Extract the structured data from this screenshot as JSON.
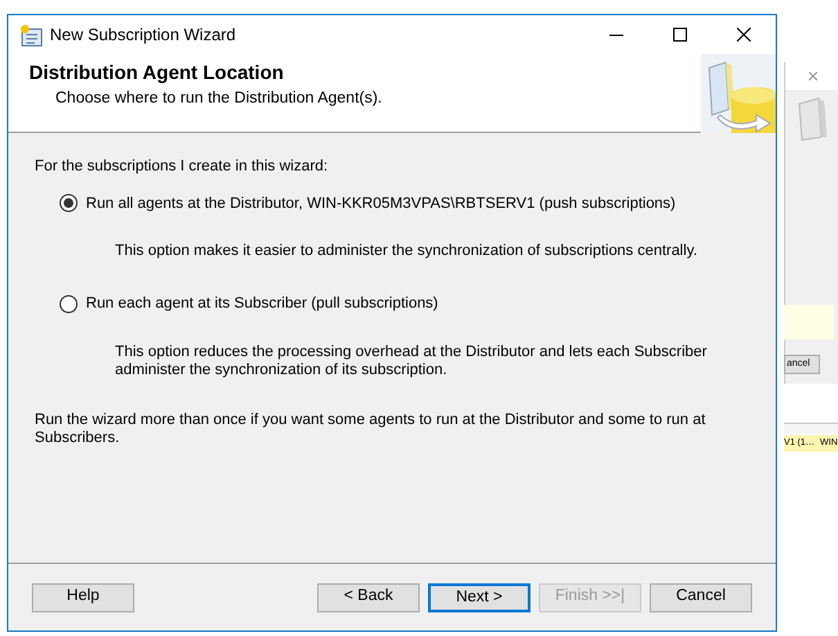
{
  "background_window": {
    "button": "ancel",
    "cells": [
      "V1 (1…",
      "WIN"
    ]
  },
  "window": {
    "title": "New Subscription Wizard"
  },
  "header": {
    "title": "Distribution Agent Location",
    "subtitle": "Choose where to run the Distribution Agent(s)."
  },
  "intro": "For the subscriptions I create in this wizard:",
  "options": [
    {
      "label": "Run all agents at the Distributor, WIN-KKR05M3VPAS\\RBTSERV1 (push subscriptions)",
      "description": "This option makes it easier to administer the synchronization of subscriptions centrally.",
      "selected": true
    },
    {
      "label": "Run each agent at its Subscriber (pull subscriptions)",
      "description": "This option reduces the processing overhead at the Distributor and lets each Subscriber administer the synchronization of its subscription.",
      "selected": false
    }
  ],
  "note": "Run the wizard more than once if you want some agents to run at the Distributor and some to run at Subscribers.",
  "buttons": [
    {
      "label": "Help",
      "disabled": false,
      "default": false
    },
    {
      "label": "< Back",
      "disabled": false,
      "default": false
    },
    {
      "label": "Next >",
      "disabled": false,
      "default": true
    },
    {
      "label": "Finish >>|",
      "disabled": true,
      "default": false
    },
    {
      "label": "Cancel",
      "disabled": false,
      "default": false
    }
  ]
}
